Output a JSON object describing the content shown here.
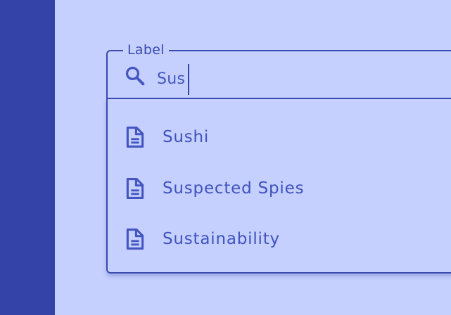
{
  "theme": {
    "background": "#c5d0ff",
    "sidebar": "#3443a8",
    "accent": "#3a4ab0",
    "text": "#4556c0"
  },
  "search": {
    "label": "Label",
    "value": "Sus",
    "icon": "search-icon"
  },
  "suggestions": [
    {
      "label": "Sushi",
      "icon": "document-icon"
    },
    {
      "label": "Suspected Spies",
      "icon": "document-icon"
    },
    {
      "label": "Sustainability",
      "icon": "document-icon"
    }
  ]
}
